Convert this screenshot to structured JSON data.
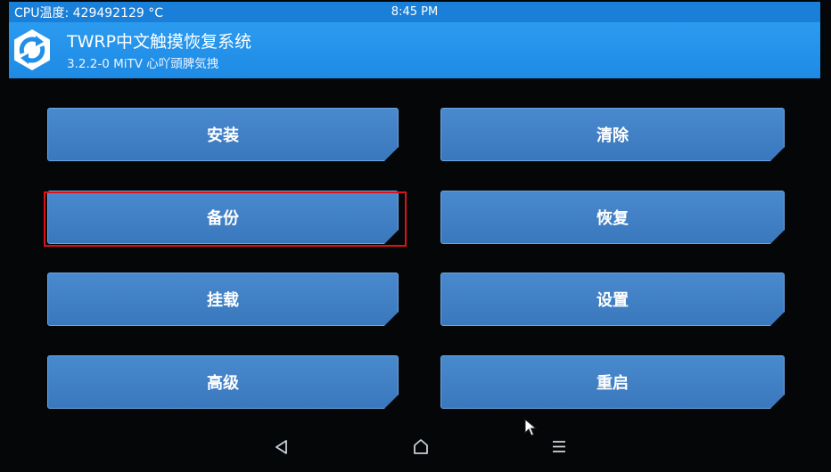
{
  "status_bar": {
    "cpu_temp": "CPU温度: 429492129 °C",
    "time": "8:45 PM"
  },
  "header": {
    "title": "TWRP中文触摸恢复系统",
    "version": "3.2.2-0 MiTV 心吖頭脾気拽",
    "logo_icon": "twrp-logo-icon"
  },
  "menu": {
    "install": "安装",
    "wipe": "清除",
    "backup": "备份",
    "restore": "恢复",
    "mount": "挂载",
    "settings": "设置",
    "advanced": "高级",
    "reboot": "重启"
  },
  "nav": {
    "back_icon": "back-triangle-icon",
    "home_icon": "home-icon",
    "menu_icon": "menu-lines-icon"
  },
  "colors": {
    "status_bar": "#1a7fd8",
    "header": "#2393ea",
    "button": "#3f7fc4",
    "highlight": "#e0101a",
    "background": "#050608"
  }
}
